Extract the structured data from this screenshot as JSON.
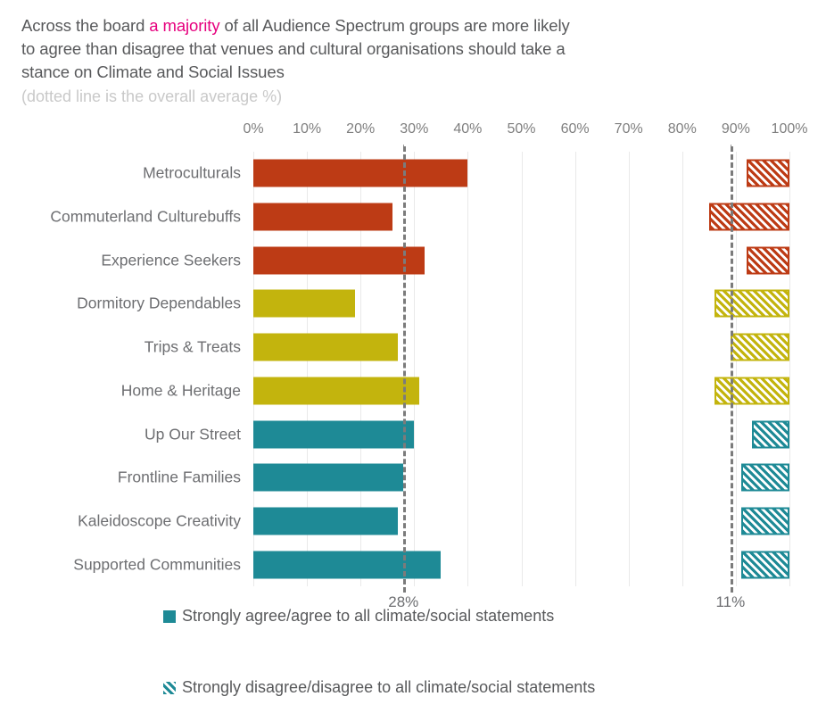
{
  "title": {
    "line1_pre": "Across the board ",
    "line1_highlight": "a majority",
    "line1_post": " of all Audience Spectrum groups are more likely",
    "line2": "to agree than disagree that venues and cultural organisations should take a",
    "line3": "stance on Climate and Social Issues",
    "subtitle": "(dotted line is the overall average %)",
    "highlight_color": "#e6007e"
  },
  "legend": [
    {
      "label": "Strongly agree/agree to all climate/social statements",
      "style": "solid",
      "color": "#1e8a96"
    },
    {
      "label": "Strongly disagree/disagree to all climate/social statements",
      "style": "hatched",
      "color": "#1e8a96"
    }
  ],
  "annotations": {
    "agree_average_label": "28%",
    "disagree_average_label": "11%"
  },
  "chart_data": {
    "type": "bar",
    "orientation": "horizontal",
    "title": "Across the board a majority of all Audience Spectrum groups are more likely to agree than disagree that venues and cultural organisations should take a stance on Climate and Social Issues",
    "subtitle": "(dotted line is the overall average %)",
    "xlabel": "",
    "ylabel": "",
    "xlim": [
      0,
      100
    ],
    "grid": true,
    "legend_position": "bottom-left",
    "tick_labels": [
      "0%",
      "10%",
      "20%",
      "30%",
      "40%",
      "50%",
      "60%",
      "70%",
      "80%",
      "90%",
      "100%"
    ],
    "tick_values": [
      0,
      10,
      20,
      30,
      40,
      50,
      60,
      70,
      80,
      90,
      100
    ],
    "categories": [
      "Metroculturals",
      "Commuterland Culturebuffs",
      "Experience Seekers",
      "Dormitory Dependables",
      "Trips & Treats",
      "Home & Heritage",
      "Up Our Street",
      "Frontline Families",
      "Kaleidoscope Creativity",
      "Supported Communities"
    ],
    "category_colors": [
      "#bd3b15",
      "#bd3b15",
      "#bd3b15",
      "#c3b40d",
      "#c3b40d",
      "#c3b40d",
      "#1e8a96",
      "#1e8a96",
      "#1e8a96",
      "#1e8a96"
    ],
    "series": [
      {
        "name": "Strongly agree/agree to all climate/social statements",
        "style": "solid",
        "anchor": "left",
        "values": [
          40,
          26,
          32,
          19,
          27,
          31,
          30,
          28,
          27,
          35
        ]
      },
      {
        "name": "Strongly disagree/disagree to all climate/social statements",
        "style": "hatched",
        "anchor": "right",
        "values": [
          8,
          15,
          8,
          14,
          11,
          14,
          7,
          9,
          9,
          9
        ]
      }
    ],
    "reference_lines": [
      {
        "label": "28%",
        "value": 28,
        "series": "agree",
        "style": "dashed",
        "color": "#7b7b7b"
      },
      {
        "label": "11%",
        "value": 89,
        "series": "disagree",
        "style": "dashed",
        "color": "#7b7b7b"
      }
    ]
  }
}
